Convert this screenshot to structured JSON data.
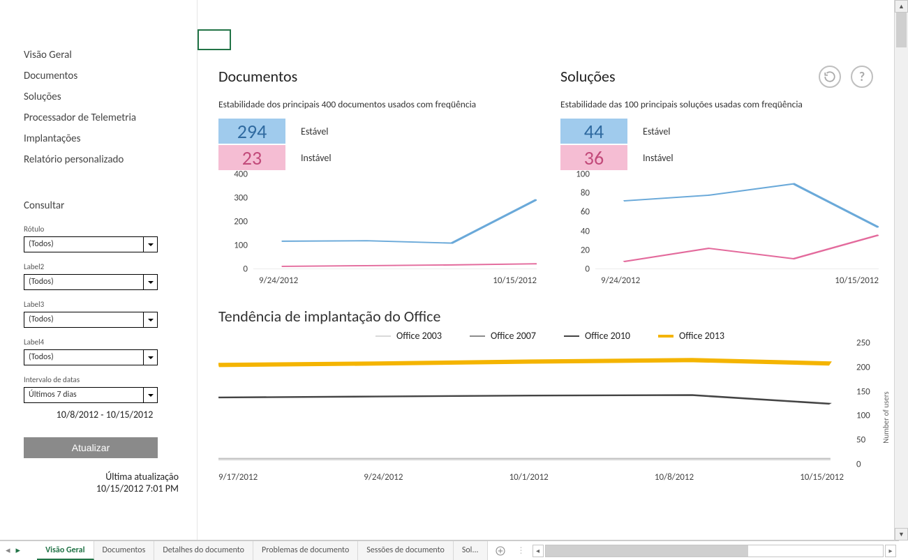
{
  "sidebar": {
    "nav": [
      "Visão Geral",
      "Documentos",
      "Soluções",
      "Processador de Telemetria",
      "Implantações",
      "Relatório personalizado"
    ],
    "consult_label": "Consultar",
    "filters": [
      {
        "label": "Rótulo",
        "value": "(Todos)"
      },
      {
        "label": "Label2",
        "value": "(Todos)"
      },
      {
        "label": "Label3",
        "value": "(Todos)"
      },
      {
        "label": "Label4",
        "value": "(Todos)"
      },
      {
        "label": "Intervalo de datas",
        "value": "Últimos 7 dias"
      }
    ],
    "date_range": "10/8/2012 - 10/15/2012",
    "update_btn": "Atualizar",
    "last_update_label": "Última atualização",
    "last_update_value": "10/15/2012 7:01 PM"
  },
  "main": {
    "documents": {
      "title": "Documentos",
      "subtitle": "Estabilidade dos principais 400 documentos usados com freqüência",
      "stable_count": "294",
      "stable_label": "Estável",
      "unstable_count": "23",
      "unstable_label": "Instável"
    },
    "solutions": {
      "title": "Soluções",
      "subtitle": "Estabilidade das 100 principais soluções usadas com freqüência",
      "stable_count": "44",
      "stable_label": "Estável",
      "unstable_count": "36",
      "unstable_label": "Instável"
    },
    "doc_chart_yticks": [
      "400",
      "300",
      "200",
      "100",
      "0"
    ],
    "sol_chart_yticks": [
      "100",
      "80",
      "60",
      "40",
      "20",
      "0"
    ],
    "mini_xticks": [
      "9/24/2012",
      "10/15/2012"
    ],
    "deploy_title": "Tendência de implantação do Office",
    "legend": [
      "Office 2003",
      "Office 2007",
      "Office 2010",
      "Office 2013"
    ],
    "deploy_yticks": [
      "250",
      "200",
      "150",
      "100",
      "50",
      "0"
    ],
    "deploy_ylabel": "Number of users",
    "deploy_xticks": [
      "9/17/2012",
      "9/24/2012",
      "10/1/2012",
      "10/8/2012",
      "10/15/2012"
    ]
  },
  "tabs": [
    "Visão Geral",
    "Documentos",
    "Detalhes do documento",
    "Problemas de documento",
    "Sessões de documento",
    "Sol..."
  ],
  "chart_data": [
    {
      "type": "line",
      "title": "Documentos",
      "x": [
        "9/24/2012",
        "10/1/2012",
        "10/8/2012",
        "10/15/2012"
      ],
      "series": [
        {
          "name": "Estável",
          "color": "#6aa9d9",
          "values": [
            118,
            120,
            110,
            294
          ]
        },
        {
          "name": "Instável",
          "color": "#e36a9c",
          "values": [
            12,
            15,
            18,
            23
          ]
        }
      ],
      "ylim": [
        0,
        400
      ]
    },
    {
      "type": "line",
      "title": "Soluções",
      "x": [
        "9/24/2012",
        "10/1/2012",
        "10/8/2012",
        "10/15/2012"
      ],
      "series": [
        {
          "name": "Estável",
          "color": "#6aa9d9",
          "values": [
            72,
            78,
            90,
            44
          ]
        },
        {
          "name": "Instável",
          "color": "#e36a9c",
          "values": [
            8,
            22,
            11,
            36
          ]
        }
      ],
      "ylim": [
        0,
        100
      ]
    },
    {
      "type": "line",
      "title": "Tendência de implantação do Office",
      "x": [
        "9/17/2012",
        "9/24/2012",
        "10/1/2012",
        "10/8/2012",
        "10/15/2012"
      ],
      "series": [
        {
          "name": "Office 2003",
          "color": "#d9d9d9",
          "values": [
            10,
            10,
            10,
            10,
            10
          ]
        },
        {
          "name": "Office 2007",
          "color": "#bfbfbf",
          "values": [
            12,
            12,
            12,
            12,
            12
          ]
        },
        {
          "name": "Office 2010",
          "color": "#444444",
          "values": [
            138,
            140,
            142,
            143,
            125
          ]
        },
        {
          "name": "Office 2013",
          "color": "#f4b400",
          "values": [
            205,
            208,
            212,
            215,
            208
          ]
        }
      ],
      "ylabel": "Number of users",
      "ylim": [
        0,
        250
      ]
    }
  ]
}
